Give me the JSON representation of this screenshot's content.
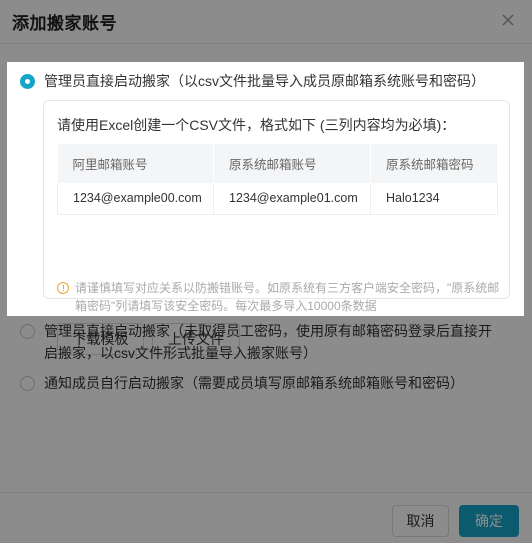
{
  "dialog": {
    "title": "添加搬家账号",
    "close_icon": "close-icon"
  },
  "options": [
    {
      "label": "管理员直接启动搬家（以csv文件批量导入成员原邮箱系统账号和密码）",
      "checked": true
    },
    {
      "label": "管理员直接启动搬家（未取得员工密码，使用原有邮箱密码登录后直接开启搬家，以csv文件形式批量导入搬家账号）",
      "checked": false
    },
    {
      "label": "通知成员自行启动搬家（需要成员填写原邮箱系统邮箱账号和密码）",
      "checked": false
    }
  ],
  "card": {
    "instruction": "请使用Excel创建一个CSV文件，格式如下 (三列内容均为必填)：",
    "table": {
      "headers": [
        "阿里邮箱账号",
        "原系统邮箱账号",
        "原系统邮箱密码"
      ],
      "row": [
        "1234@example00.com",
        "1234@example01.com",
        "Halo1234"
      ]
    },
    "notice_icon": "warning-circle-icon",
    "notice": "请谨慎填写对应关系以防搬错账号。如原系统有三方客户端安全密码，\"原系统邮箱密码\"列请填写该安全密码。每次最多导入10000条数据",
    "download_label": "下载模板",
    "upload_label": "上传文件"
  },
  "footer": {
    "cancel_label": "取消",
    "ok_label": "确定"
  },
  "colors": {
    "accent": "#14a5c8",
    "warning": "#f0a030"
  }
}
